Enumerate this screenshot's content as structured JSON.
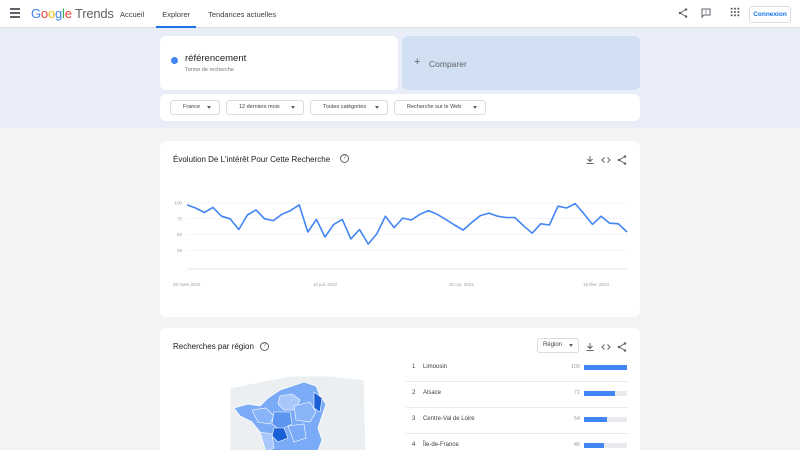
{
  "header": {
    "logo": {
      "g1": "G",
      "g2": "o",
      "g3": "o",
      "g4": "g",
      "g5": "l",
      "g6": "e",
      "trends": "Trends"
    },
    "nav": [
      "Accueil",
      "Explorer",
      "Tendances actuelles"
    ],
    "active_nav": "Explorer",
    "signin": "Connexion",
    "icons": [
      "share-icon",
      "feedback-icon",
      "apps-icon"
    ]
  },
  "search": {
    "term": "référencement",
    "term_type": "Terme de recherche",
    "term_color": "#4285f4",
    "compare_plus": "+",
    "compare_label": "Comparer"
  },
  "filters": [
    "France",
    "12 derniers mois",
    "Toutes catégories",
    "Recherche sur le Web"
  ],
  "interest": {
    "title": "Évolution De L'intérêt Pour Cette Recherche",
    "help": "?"
  },
  "chart_data": {
    "type": "line",
    "title": "Évolution De L'intérêt Pour Cette Recherche",
    "ylim": [
      0,
      100
    ],
    "yticks": [
      100,
      75,
      50,
      25
    ],
    "xtick_labels": [
      "20 mars 2022",
      "10 juil. 2022",
      "30 oct. 2022",
      "19 févr. 2023"
    ],
    "grid": true,
    "color": "#4285f4",
    "series": [
      {
        "values": [
          97,
          92,
          85,
          93,
          79,
          75,
          58,
          81,
          89,
          75,
          72,
          82,
          88,
          97,
          54,
          74,
          46,
          66,
          74,
          43,
          58,
          35,
          51,
          79,
          61,
          76,
          73,
          82,
          88,
          82,
          74,
          65,
          57,
          69,
          80,
          84,
          79,
          77,
          77,
          64,
          52,
          67,
          65,
          95,
          92,
          99,
          83,
          66,
          79,
          68,
          67,
          54
        ]
      }
    ]
  },
  "region": {
    "title": "Recherches par région",
    "help": "?",
    "select": "Région",
    "rows": [
      {
        "rank": "1",
        "name": "Limousin",
        "value": "100",
        "pct": 100
      },
      {
        "rank": "2",
        "name": "Alsace",
        "value": "71",
        "pct": 71
      },
      {
        "rank": "3",
        "name": "Centre-Val de Loire",
        "value": "54",
        "pct": 54
      },
      {
        "rank": "4",
        "name": "Île-de-France",
        "value": "46",
        "pct": 46
      }
    ]
  }
}
